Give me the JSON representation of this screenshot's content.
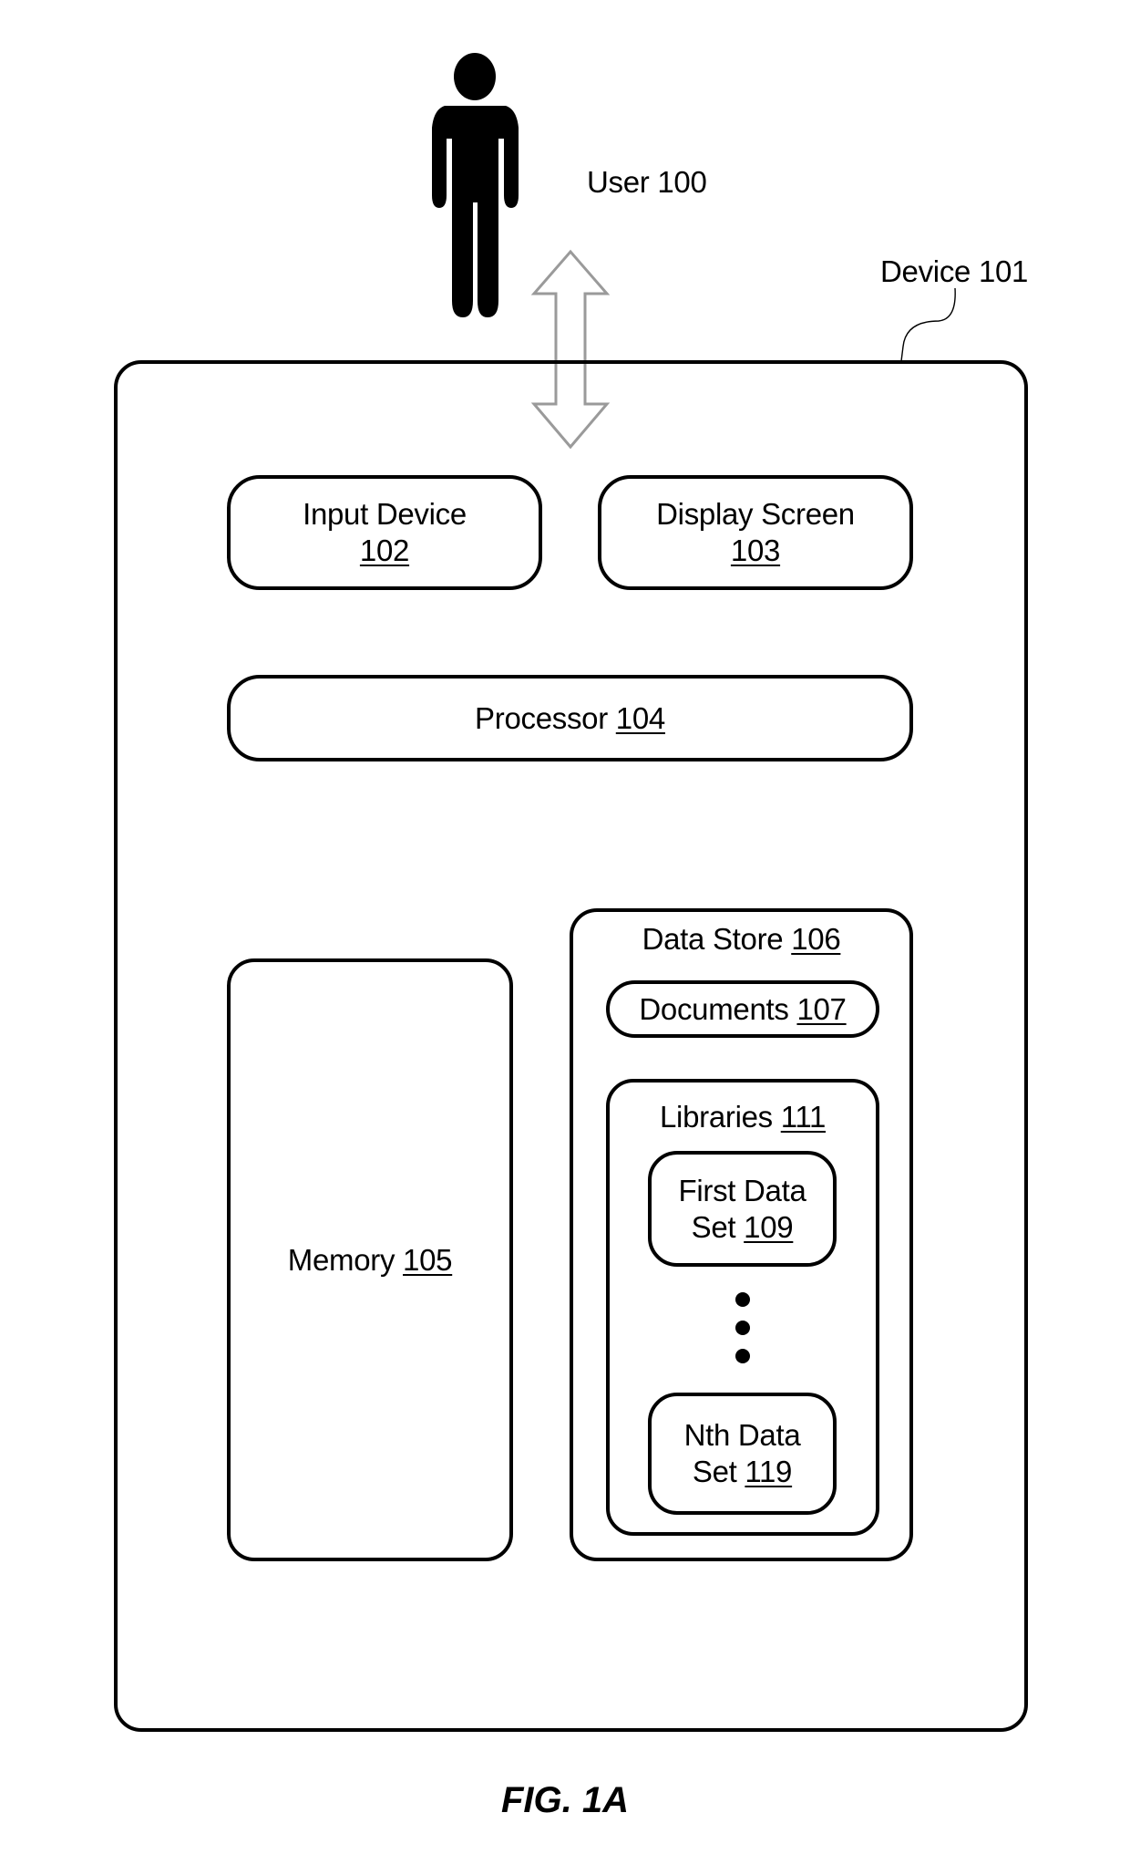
{
  "figure": {
    "caption": "FIG. 1A"
  },
  "user": {
    "label": "User",
    "ref": "100",
    "icon": "person-icon"
  },
  "device": {
    "label": "Device",
    "ref": "101"
  },
  "arrow": {
    "icon": "bidirectional-arrow-icon",
    "direction": "up-down"
  },
  "components": {
    "input_device": {
      "label": "Input Device",
      "ref": "102"
    },
    "display_screen": {
      "label": "Display Screen",
      "ref": "103"
    },
    "processor": {
      "label": "Processor",
      "ref": "104"
    },
    "memory": {
      "label": "Memory",
      "ref": "105"
    },
    "data_store": {
      "label": "Data Store",
      "ref": "106"
    },
    "documents": {
      "label": "Documents",
      "ref": "107"
    },
    "libraries": {
      "label": "Libraries",
      "ref": "111"
    },
    "first_data_set": {
      "line1": "First Data",
      "line2": "Set",
      "ref": "109"
    },
    "ellipsis": {
      "icon": "vertical-ellipsis-icon"
    },
    "nth_data_set": {
      "line1": "Nth Data",
      "line2": "Set",
      "ref": "119"
    }
  }
}
